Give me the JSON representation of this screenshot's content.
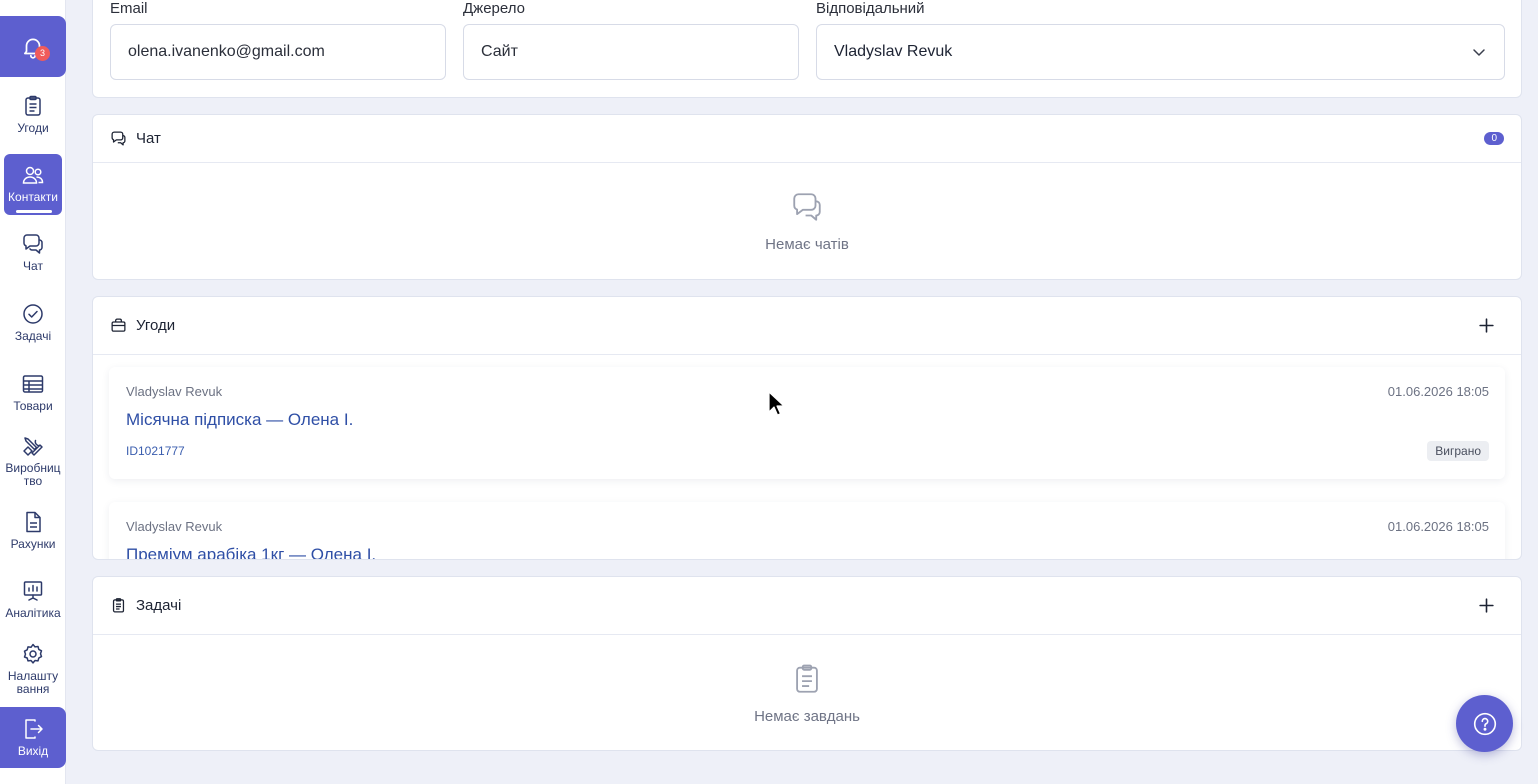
{
  "sidebar": {
    "notification_count": "3",
    "items": [
      {
        "label": "Угоди",
        "icon": "clipboard-icon"
      },
      {
        "label": "Контакти",
        "icon": "users-icon"
      },
      {
        "label": "Чат",
        "icon": "chat-icon"
      },
      {
        "label": "Задачі",
        "icon": "check-circle-icon"
      },
      {
        "label": "Товари",
        "icon": "table-icon"
      },
      {
        "label": "Виробниц тво",
        "icon": "tools-icon"
      },
      {
        "label": "Рахунки",
        "icon": "document-icon"
      },
      {
        "label": "Аналітика",
        "icon": "chart-icon"
      },
      {
        "label": "Налашту вання",
        "icon": "gear-icon"
      }
    ],
    "active": "Контакти",
    "logout_label": "Вихід"
  },
  "form": {
    "email_label": "Email",
    "email_value": "olena.ivanenko@gmail.com",
    "source_label": "Джерело",
    "source_value": "Сайт",
    "responsible_label": "Відповідальний",
    "responsible_value": "Vladyslav Revuk"
  },
  "chat": {
    "title": "Чат",
    "count": "0",
    "empty_text": "Немає чатів"
  },
  "deals": {
    "title": "Угоди",
    "items": [
      {
        "owner": "Vladyslav Revuk",
        "date": "01.06.2026 18:05",
        "name": "Місячна підписка — Олена І.",
        "id": "ID1021777",
        "status": "Виграно"
      },
      {
        "owner": "Vladyslav Revuk",
        "date": "01.06.2026 18:05",
        "name": "Преміум арабіка 1кг — Олена І."
      }
    ]
  },
  "tasks": {
    "title": "Задачі",
    "empty_text": "Немає завдань"
  },
  "colors": {
    "accent": "#5d5fcf",
    "link": "#2f4fa6",
    "background": "#eef0f8"
  }
}
